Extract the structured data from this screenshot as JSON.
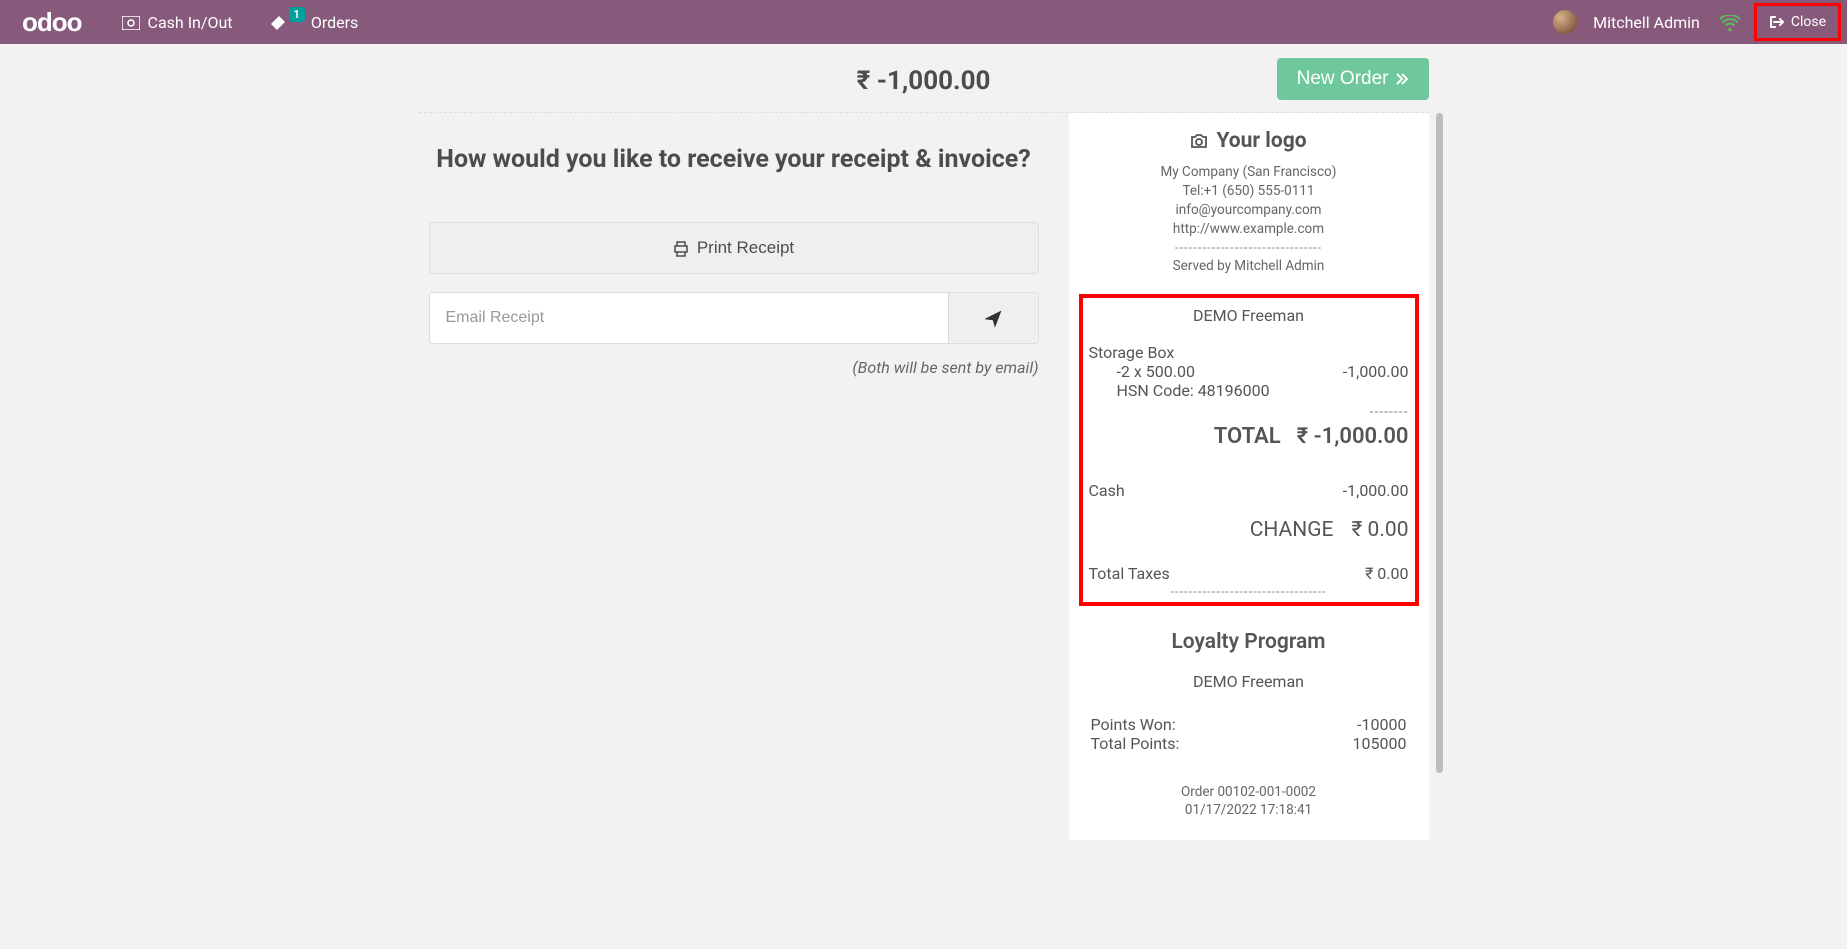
{
  "topbar": {
    "logo": "odoo",
    "cash": "Cash In/Out",
    "orders": "Orders",
    "orders_badge": "1",
    "user": "Mitchell Admin",
    "close": "Close"
  },
  "summary": {
    "amount": "₹ -1,000.00",
    "new_order": "New Order"
  },
  "left": {
    "question": "How would you like to receive your receipt & invoice?",
    "print": "Print Receipt",
    "email_placeholder": "Email Receipt",
    "note": "(Both will be sent by email)"
  },
  "receipt": {
    "logo_text": "Your logo",
    "company": "My Company (San Francisco)",
    "tel": "Tel:+1 (650) 555-0111",
    "email": "info@yourcompany.com",
    "url": "http://www.example.com",
    "served": "Served by Mitchell Admin",
    "customer": "DEMO Freeman",
    "item_name": "Storage Box",
    "item_qty": "-2 x 500.00",
    "item_total": "-1,000.00",
    "hsn": "HSN Code: 48196000",
    "total_label": "TOTAL",
    "total_value": "₹ -1,000.00",
    "pay_method": "Cash",
    "pay_value": "-1,000.00",
    "change_label": "CHANGE",
    "change_value": "₹ 0.00",
    "tax_label": "Total Taxes",
    "tax_value": "₹ 0.00",
    "loyalty_title": "Loyalty Program",
    "loyalty_customer": "DEMO Freeman",
    "points_won_label": "Points Won:",
    "points_won_value": "-10000",
    "total_points_label": "Total Points:",
    "total_points_value": "105000",
    "order_ref": "Order 00102-001-0002",
    "order_date": "01/17/2022 17:18:41"
  }
}
